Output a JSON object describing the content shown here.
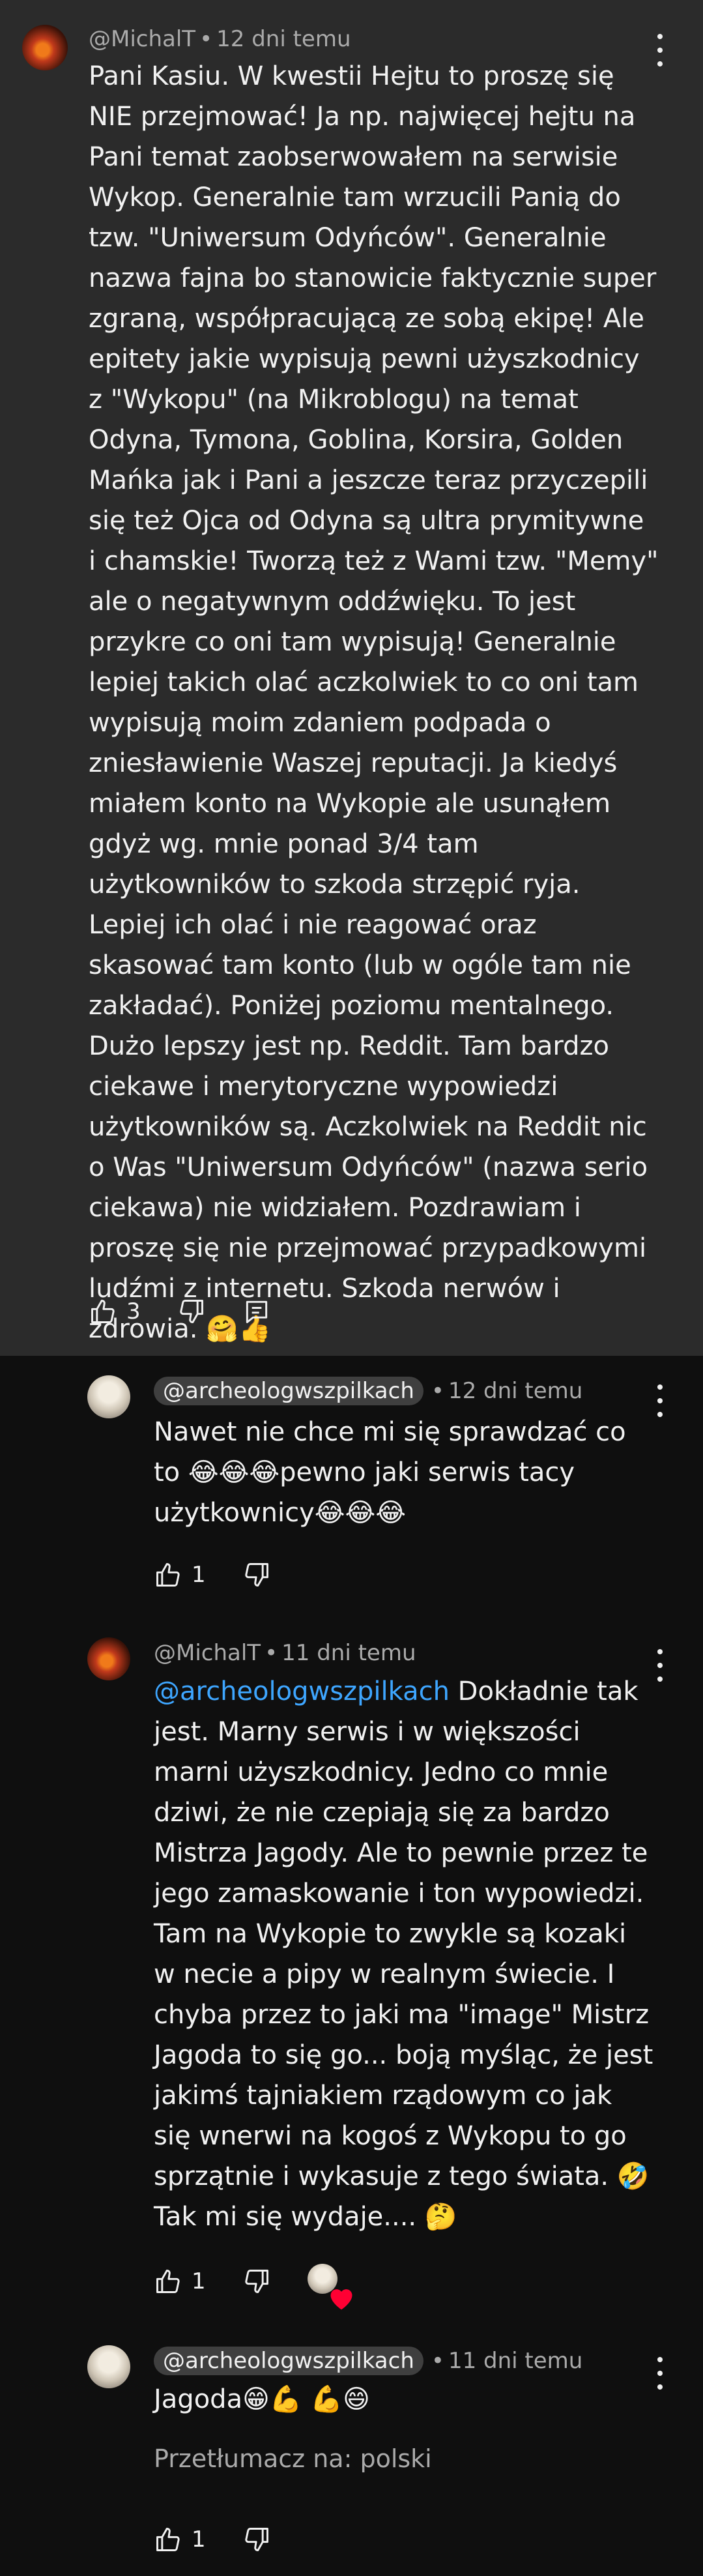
{
  "comments": [
    {
      "author": "@MichalT",
      "time": "12 dni temu",
      "text": "Pani Kasiu. W kwestii Hejtu to proszę się NIE przejmować! Ja np. najwięcej hejtu na Pani temat zaobserwowałem na serwisie Wykop. Generalnie tam wrzucili Panią do tzw. \"Uniwersum Odyńców\". Generalnie nazwa fajna bo stanowicie faktycznie super zgraną, współpracującą ze sobą ekipę! Ale epitety jakie wypisują pewni użyszkodnicy z \"Wykopu\" (na Mikroblogu) na temat Odyna, Tymona, Goblina, Korsira, Golden Mańka jak i Pani a jeszcze teraz przyczepili się też Ojca od Odyna są ultra prymitywne i chamskie! Tworzą też z Wami tzw. \"Memy\" ale o negatywnym oddźwięku. To jest przykre co oni tam wypisują! Generalnie lepiej takich olać aczkolwiek to co oni tam wypisują moim zdaniem podpada o zniesławienie Waszej reputacji. Ja kiedyś miałem konto na Wykopie ale usunąłem gdyż wg. mnie ponad 3/4 tam użytkowników to szkoda strzępić ryja. Lepiej ich olać i nie reagować oraz skasować tam konto (lub w ogóle tam nie zakładać). Poniżej poziomu mentalnego. Dużo lepszy jest np. Reddit. Tam bardzo ciekawe i merytoryczne wypowiedzi użytkowników są. Aczkolwiek na Reddit nic o Was \"Uniwersum Odyńców\" (nazwa serio ciekawa) nie widziałem. Pozdrawiam i proszę się nie przejmować przypadkowymi ludźmi z internetu. Szkoda nerwów i zdrowia. 🤗👍",
      "likes": "3"
    },
    {
      "author": "@archeologwszpilkach",
      "time": "12 dni temu",
      "text": "Nawet nie chce mi się sprawdzać co to 😂😂😂pewno jaki serwis tacy użytkownicy😂😂😂",
      "likes": "1"
    },
    {
      "author": "@MichalT",
      "time": "11 dni temu",
      "mention": "@archeologwszpilkach",
      "text": " Dokładnie tak jest. Marny serwis i w większości marni użyszkodnicy. Jedno co mnie dziwi, że nie czepiają się za bardzo Mistrza Jagody. Ale to pewnie przez te jego zamaskowanie i ton wypowiedzi. Tam na Wykopie to zwykle są kozaki w necie a pipy w realnym świecie. I chyba przez to jaki ma \"image\" Mistrz Jagoda to się go... boją myśląc, że jest jakimś tajniakiem rządowym co jak się wnerwi na kogoś z Wykopu to go sprzątnie i wykasuje z tego świata. 🤣 Tak mi się wydaje.... 🤔",
      "likes": "1"
    },
    {
      "author": "@archeologwszpilkach",
      "time": "11 dni temu",
      "text": "Jagoda😁💪 💪😄",
      "translate": "Przetłumacz na: polski",
      "likes": "1"
    }
  ],
  "separator": "•",
  "icons": {
    "like": "thumbs-up-icon",
    "dislike": "thumbs-down-icon",
    "reply": "reply-icon",
    "menu": "more-vert-icon",
    "creator_heart": "creator-heart-icon"
  },
  "colors": {
    "parent_bg": "#2b2b2b",
    "page_bg": "#0f0f0f",
    "mention": "#3ea6ff",
    "meta": "#aaaaaa",
    "heart": "#ff0033"
  }
}
